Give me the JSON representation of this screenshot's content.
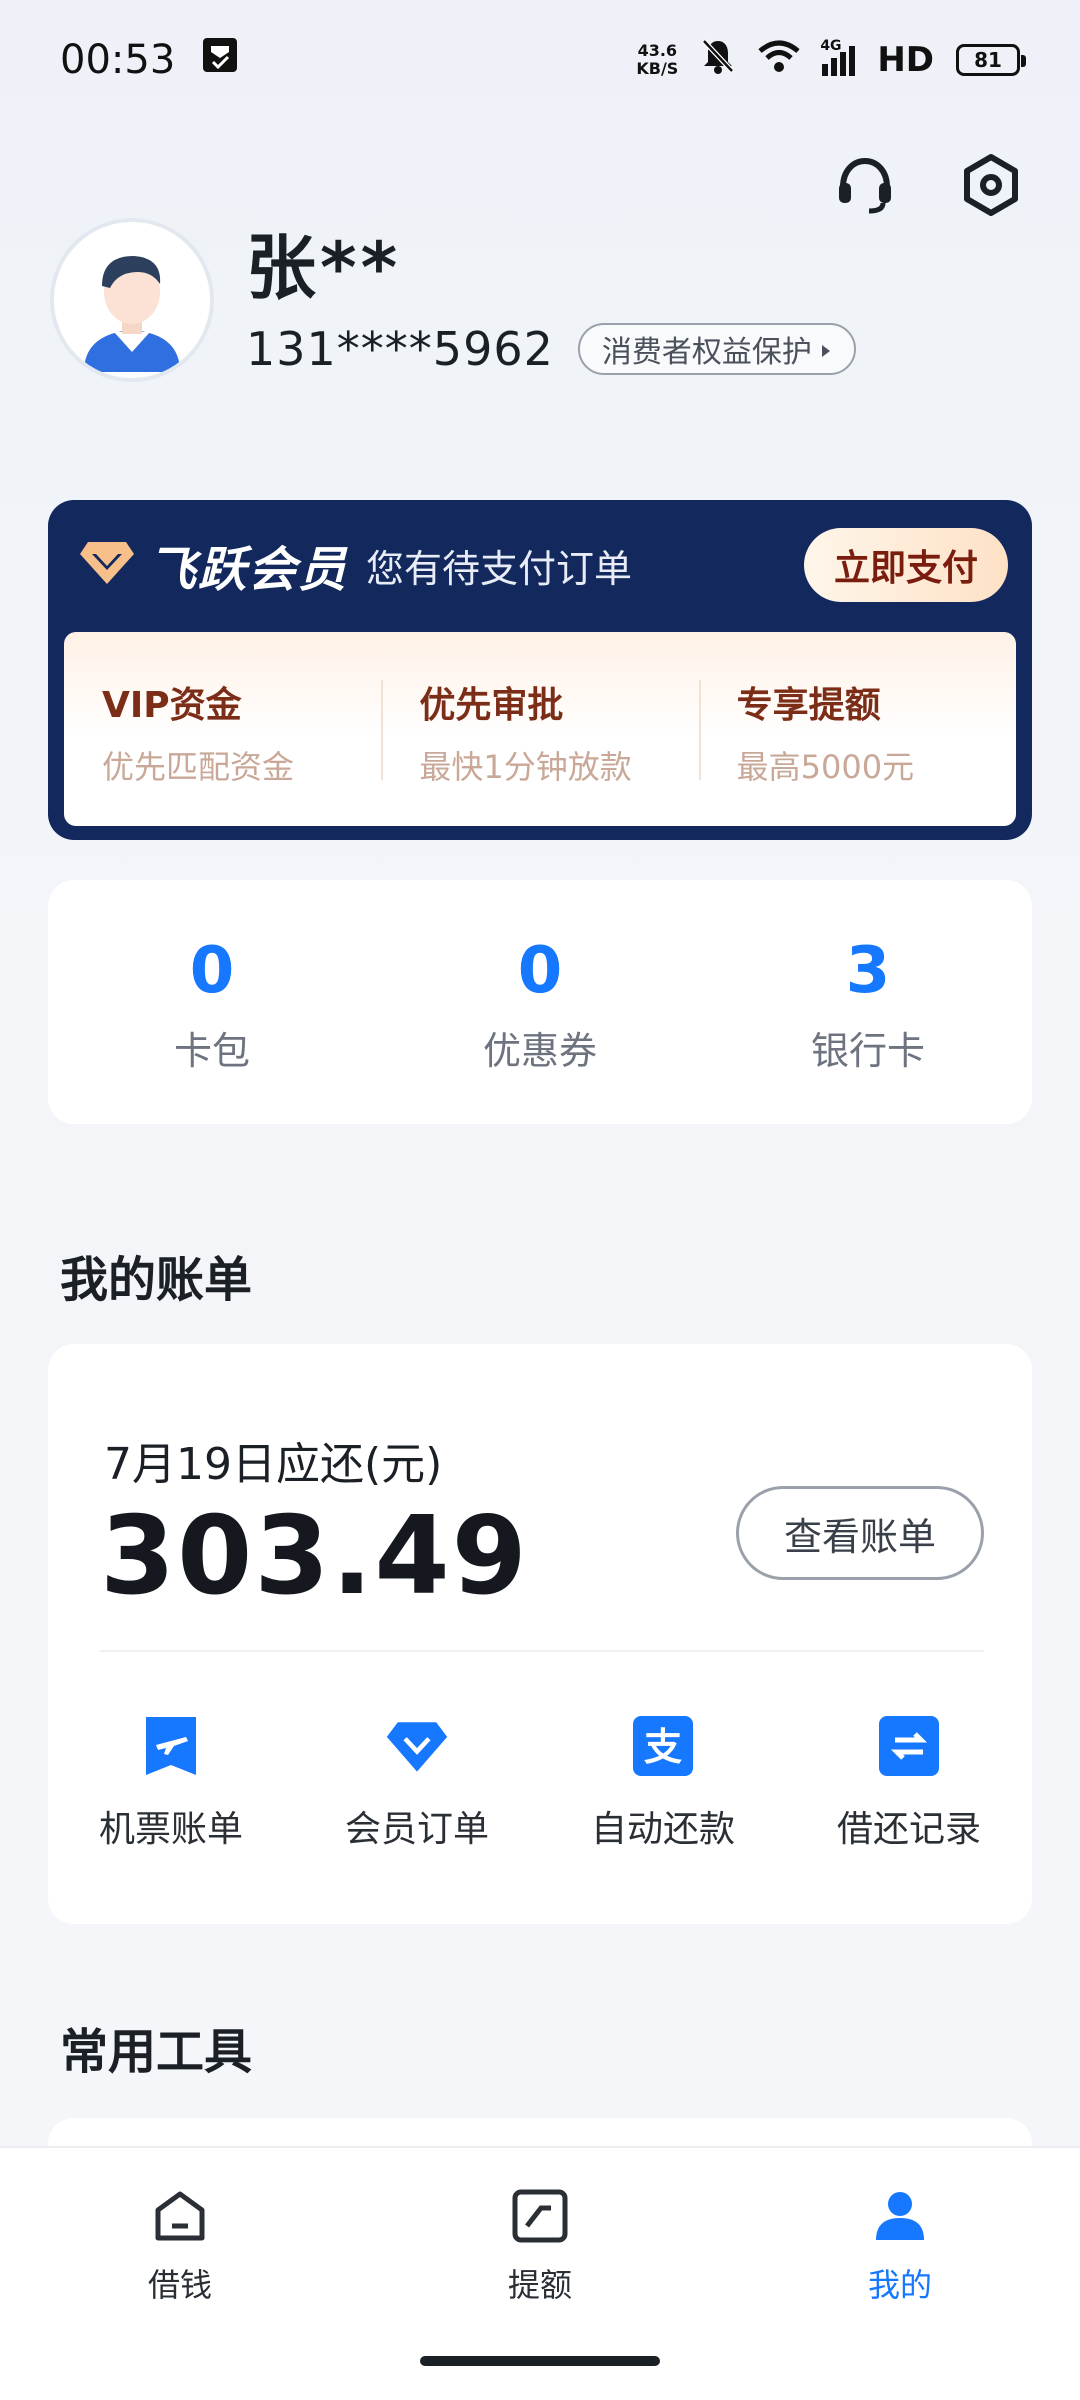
{
  "status_bar": {
    "time": "00:53",
    "net_speed_value": "43.6",
    "net_speed_unit": "KB/S",
    "network": "4G",
    "hd": "HD",
    "battery": "81"
  },
  "profile": {
    "name": "张**",
    "phone": "131****5962",
    "rights_badge": "消费者权益保护"
  },
  "vip": {
    "brand": "飞跃会员",
    "pending": "您有待支付订单",
    "pay_button": "立即支付",
    "features": [
      {
        "title": "VIP资金",
        "sub": "优先匹配资金"
      },
      {
        "title": "优先审批",
        "sub": "最快1分钟放款"
      },
      {
        "title": "专享提额",
        "sub": "最高5000元"
      }
    ]
  },
  "counts": [
    {
      "value": "0",
      "label": "卡包"
    },
    {
      "value": "0",
      "label": "优惠券"
    },
    {
      "value": "3",
      "label": "银行卡"
    }
  ],
  "bill_section": {
    "title": "我的账单",
    "due_label": "7月19日应还(元)",
    "amount": "303.49",
    "view_button": "查看账单",
    "actions": [
      {
        "label": "机票账单",
        "icon": "plane-ticket-icon"
      },
      {
        "label": "会员订单",
        "icon": "diamond-icon"
      },
      {
        "label": "自动还款",
        "icon": "alipay-icon"
      },
      {
        "label": "借还记录",
        "icon": "transfer-icon"
      }
    ]
  },
  "tools_section": {
    "title": "常用工具"
  },
  "tabs": [
    {
      "label": "借钱",
      "icon": "home-icon"
    },
    {
      "label": "提额",
      "icon": "limit-up-icon"
    },
    {
      "label": "我的",
      "icon": "person-icon",
      "active": true
    }
  ],
  "colors": {
    "accent": "#1677ff",
    "vip_navy": "#13295e",
    "vip_brown": "#7c2d17"
  }
}
